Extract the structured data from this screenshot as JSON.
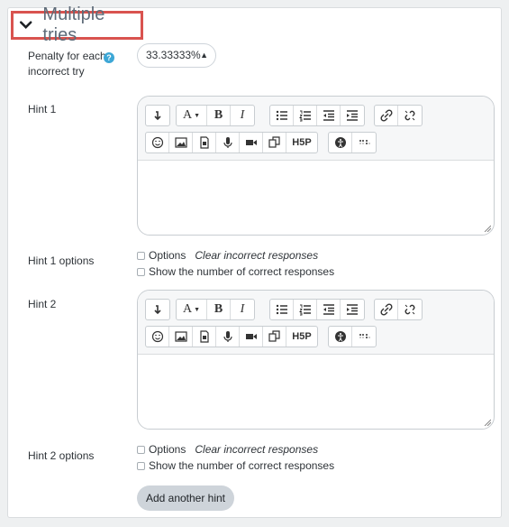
{
  "section": {
    "title": "Multiple tries"
  },
  "penalty": {
    "label": "Penalty for each incorrect try",
    "value": "33.33333%"
  },
  "hints": [
    {
      "label": "Hint 1",
      "options_label": "Hint 1 options",
      "options": [
        {
          "label": "Options",
          "extra": "Clear incorrect responses",
          "checked": false
        },
        {
          "label": "Show the number of correct responses",
          "checked": false
        }
      ]
    },
    {
      "label": "Hint 2",
      "options_label": "Hint 2 options",
      "options": [
        {
          "label": "Options",
          "extra": "Clear incorrect responses",
          "checked": false
        },
        {
          "label": "Show the number of correct responses",
          "checked": false
        }
      ]
    }
  ],
  "toolbar": {
    "font_size_label": "A",
    "bold_label": "B",
    "italic_label": "I",
    "h5p_label": "H5P"
  },
  "buttons": {
    "add_hint": "Add another hint"
  },
  "colors": {
    "highlight": "#d9534f",
    "help": "#3da7d6",
    "button": "#ced4da"
  }
}
